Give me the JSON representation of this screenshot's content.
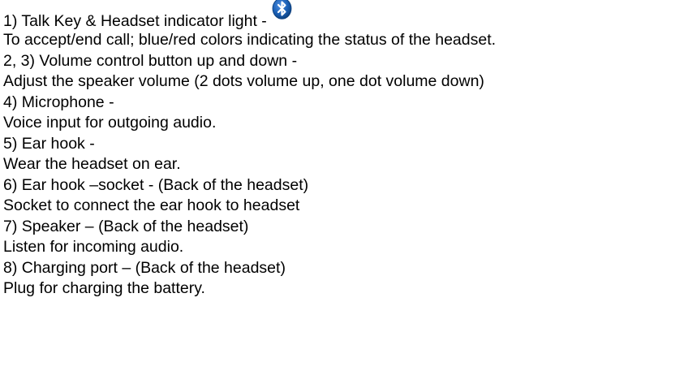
{
  "items": [
    {
      "heading": "1) Talk Key & Headset indicator light -",
      "description": "To accept/end call; blue/red colors indicating the status of the headset.",
      "icon": "bluetooth-icon"
    },
    {
      "heading": "2, 3) Volume control button up and down -",
      "description": "Adjust the speaker volume (2 dots volume up, one dot volume down)"
    },
    {
      "heading": "4) Microphone -",
      "description": "Voice input for outgoing audio."
    },
    {
      "heading": "5) Ear hook -",
      "description": "Wear the headset on ear."
    },
    {
      "heading": "6) Ear hook –socket - (Back of the headset)",
      "description": "Socket to connect the ear hook to headset"
    },
    {
      "heading": "7) Speaker – (Back of the headset)",
      "description": "Listen for incoming audio."
    },
    {
      "heading": "8) Charging port – (Back of the headset)",
      "description": "Plug for charging the battery."
    }
  ],
  "colors": {
    "text": "#000000",
    "bluetooth_badge": "#1a5fb4",
    "bluetooth_badge_dark": "#0b3d7a",
    "bluetooth_rune": "#ffffff"
  }
}
